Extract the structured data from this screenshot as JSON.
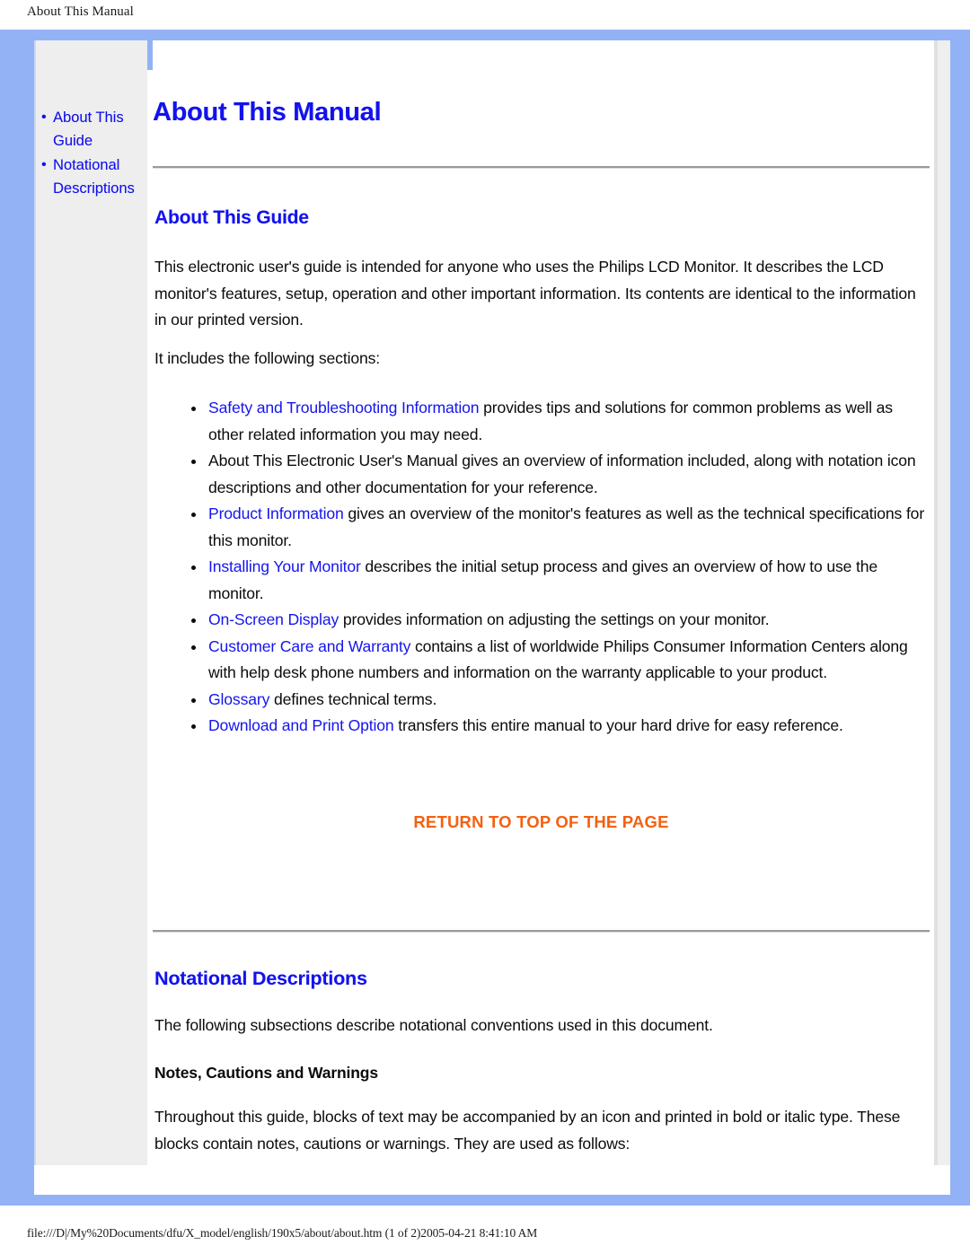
{
  "print_header": "About This Manual",
  "sidebar": {
    "items": [
      {
        "bullet": "•",
        "label": "About This Guide"
      },
      {
        "bullet": "•",
        "label": "Notational Descriptions"
      }
    ]
  },
  "main": {
    "page_title": "About This Manual",
    "sections": {
      "about_guide": {
        "heading": "About This Guide",
        "intro": "This electronic user's guide is intended for anyone who uses the Philips LCD Monitor. It describes the LCD monitor's features, setup, operation and other important information. Its contents are identical to the information in our printed version.",
        "includes_lead": "It includes the following sections:",
        "list": [
          {
            "link": "Safety and Troubleshooting Information",
            "rest": " provides tips and solutions for common problems as well as other related information you may need."
          },
          {
            "link": "",
            "rest": "About This Electronic User's Manual gives an overview of information included, along with notation icon descriptions and other documentation for your reference."
          },
          {
            "link": "Product Information",
            "rest": " gives an overview of the monitor's features as well as the technical specifications for this monitor."
          },
          {
            "link": "Installing Your Monitor",
            "rest": " describes the initial setup process and gives an overview of how to use the monitor."
          },
          {
            "link": "On-Screen Display",
            "rest": " provides information on adjusting the settings on your monitor."
          },
          {
            "link": "Customer Care and Warranty",
            "rest": " contains a list of worldwide Philips Consumer Information Centers along with help desk phone numbers and information on the warranty applicable to your product."
          },
          {
            "link": "Glossary",
            "rest": " defines technical terms."
          },
          {
            "link": "Download and Print Option",
            "rest": " transfers this entire manual to your hard drive for easy reference."
          }
        ],
        "return_to_top": "RETURN TO TOP OF THE PAGE"
      },
      "notational": {
        "heading": "Notational Descriptions",
        "lead": "The following subsections describe notational conventions used in this document.",
        "sub_heading": "Notes, Cautions and Warnings",
        "body": "Throughout this guide, blocks of text may be accompanied by an icon and printed in bold or italic type. These blocks contain notes, cautions or warnings. They are used as follows:"
      }
    }
  },
  "footer": "file:///D|/My%20Documents/dfu/X_model/english/190x5/about/about.htm (1 of 2)2005-04-21 8:41:10 AM",
  "colors": {
    "frame_blue": "#93b2f6",
    "sidebar_gray": "#eeeeee",
    "link_blue": "#1515ee",
    "heading_blue": "#1212ee",
    "return_orange": "#f4600f",
    "body_black": "#0b0b0b"
  }
}
